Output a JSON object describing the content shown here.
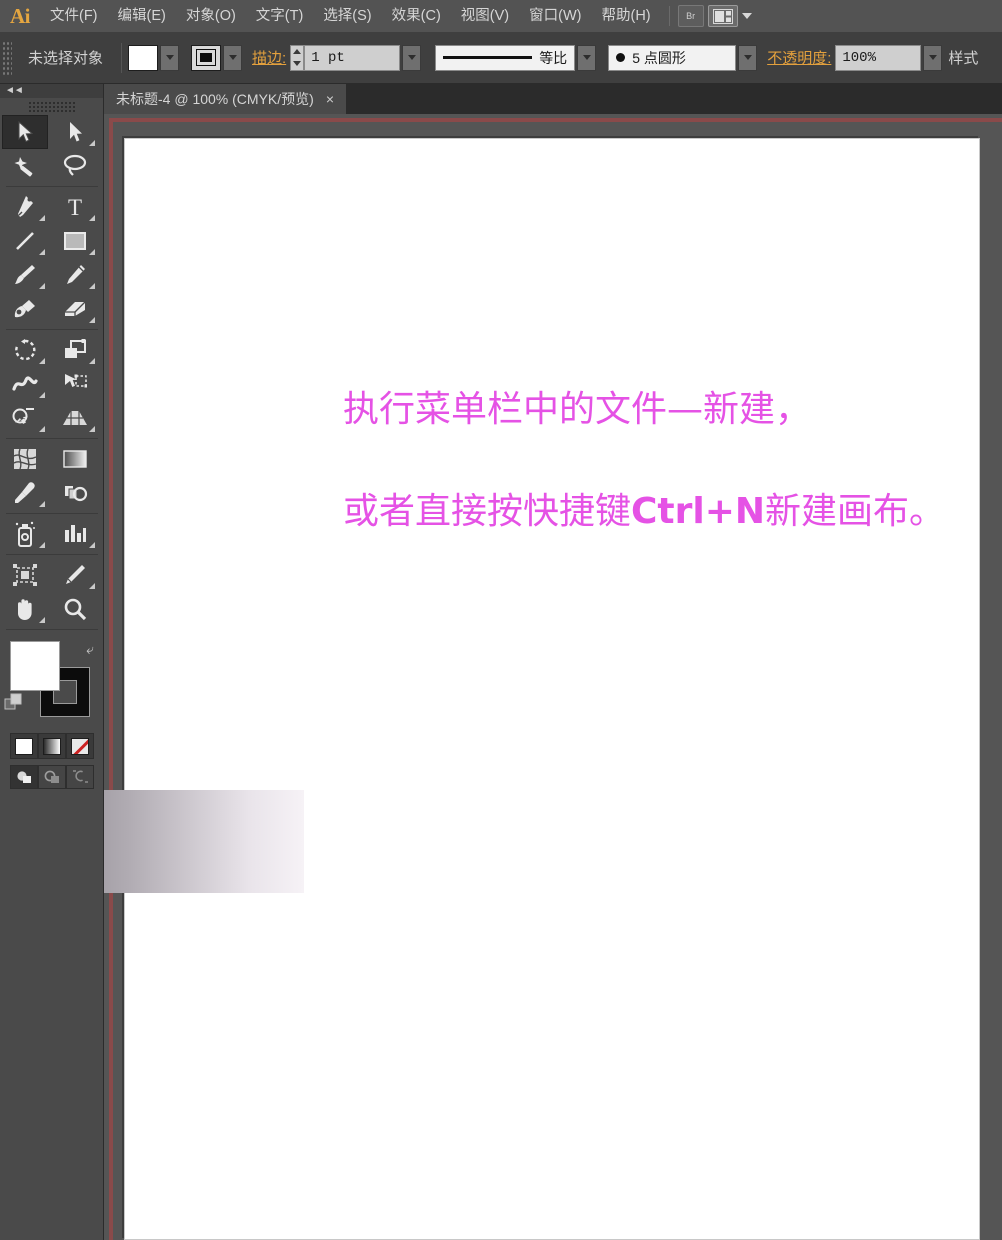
{
  "app": {
    "logo": "Ai",
    "menus": [
      {
        "label": "文件(F)"
      },
      {
        "label": "编辑(E)"
      },
      {
        "label": "对象(O)"
      },
      {
        "label": "文字(T)"
      },
      {
        "label": "选择(S)"
      },
      {
        "label": "效果(C)"
      },
      {
        "label": "视图(V)"
      },
      {
        "label": "窗口(W)"
      },
      {
        "label": "帮助(H)"
      }
    ],
    "bridge_button": "Br"
  },
  "control_bar": {
    "selection_status": "未选择对象",
    "fill_label": "填色",
    "stroke_swatch_label": "描边颜色",
    "stroke_label": "描边:",
    "stroke_weight": "1 pt",
    "profile_label": "等比",
    "brush_label": "5 点圆形",
    "opacity_label": "不透明度:",
    "opacity_value": "100%",
    "styles_label": "样式"
  },
  "tab": {
    "title": "未标题-4 @ 100% (CMYK/预览)",
    "close": "×"
  },
  "toolbar": {
    "collapse": "◄◄",
    "groups": [
      [
        {
          "name": "selection-tool",
          "active": true,
          "flyout": false
        },
        {
          "name": "direct-selection-tool",
          "active": false,
          "flyout": true
        },
        {
          "name": "magic-wand-tool",
          "active": false,
          "flyout": false
        },
        {
          "name": "lasso-tool",
          "active": false,
          "flyout": false
        }
      ],
      [
        {
          "name": "pen-tool",
          "active": false,
          "flyout": true
        },
        {
          "name": "type-tool",
          "active": false,
          "flyout": true
        },
        {
          "name": "line-segment-tool",
          "active": false,
          "flyout": true
        },
        {
          "name": "rectangle-tool",
          "active": false,
          "flyout": true
        },
        {
          "name": "paintbrush-tool",
          "active": false,
          "flyout": true
        },
        {
          "name": "pencil-tool",
          "active": false,
          "flyout": true
        },
        {
          "name": "blob-brush-tool",
          "active": false,
          "flyout": false
        },
        {
          "name": "eraser-tool",
          "active": false,
          "flyout": true
        }
      ],
      [
        {
          "name": "rotate-tool",
          "active": false,
          "flyout": true
        },
        {
          "name": "scale-tool",
          "active": false,
          "flyout": true
        },
        {
          "name": "width-tool",
          "active": false,
          "flyout": true
        },
        {
          "name": "free-transform-tool",
          "active": false,
          "flyout": false
        },
        {
          "name": "shape-builder-tool",
          "active": false,
          "flyout": true
        },
        {
          "name": "perspective-grid-tool",
          "active": false,
          "flyout": true
        }
      ],
      [
        {
          "name": "mesh-tool",
          "active": false,
          "flyout": false
        },
        {
          "name": "gradient-tool",
          "active": false,
          "flyout": false
        },
        {
          "name": "eyedropper-tool",
          "active": false,
          "flyout": true
        },
        {
          "name": "blend-tool",
          "active": false,
          "flyout": false
        }
      ],
      [
        {
          "name": "symbol-sprayer-tool",
          "active": false,
          "flyout": true
        },
        {
          "name": "column-graph-tool",
          "active": false,
          "flyout": true
        }
      ],
      [
        {
          "name": "artboard-tool",
          "active": false,
          "flyout": false
        },
        {
          "name": "slice-tool",
          "active": false,
          "flyout": true
        },
        {
          "name": "hand-tool",
          "active": false,
          "flyout": true
        },
        {
          "name": "zoom-tool",
          "active": false,
          "flyout": false
        }
      ]
    ],
    "fill_color": "#ffffff",
    "stroke_color": "#0c0c0c",
    "swap_icon": "⤶",
    "color_modes": [
      "color-swatch",
      "gradient-swatch",
      "none-swatch"
    ],
    "draw_modes": [
      "draw-normal",
      "draw-behind",
      "draw-inside"
    ]
  },
  "canvas": {
    "annotation_line1": "执行菜单栏中的文件—新建，",
    "annotation_line2_a": "或者直接按快捷键",
    "annotation_line2_b": "Ctrl+N",
    "annotation_line2_c": "新建画布。",
    "annotation_color": "#e552e5",
    "gradient_from": "#7d7a80",
    "gradient_to": "#f6f2f6"
  }
}
